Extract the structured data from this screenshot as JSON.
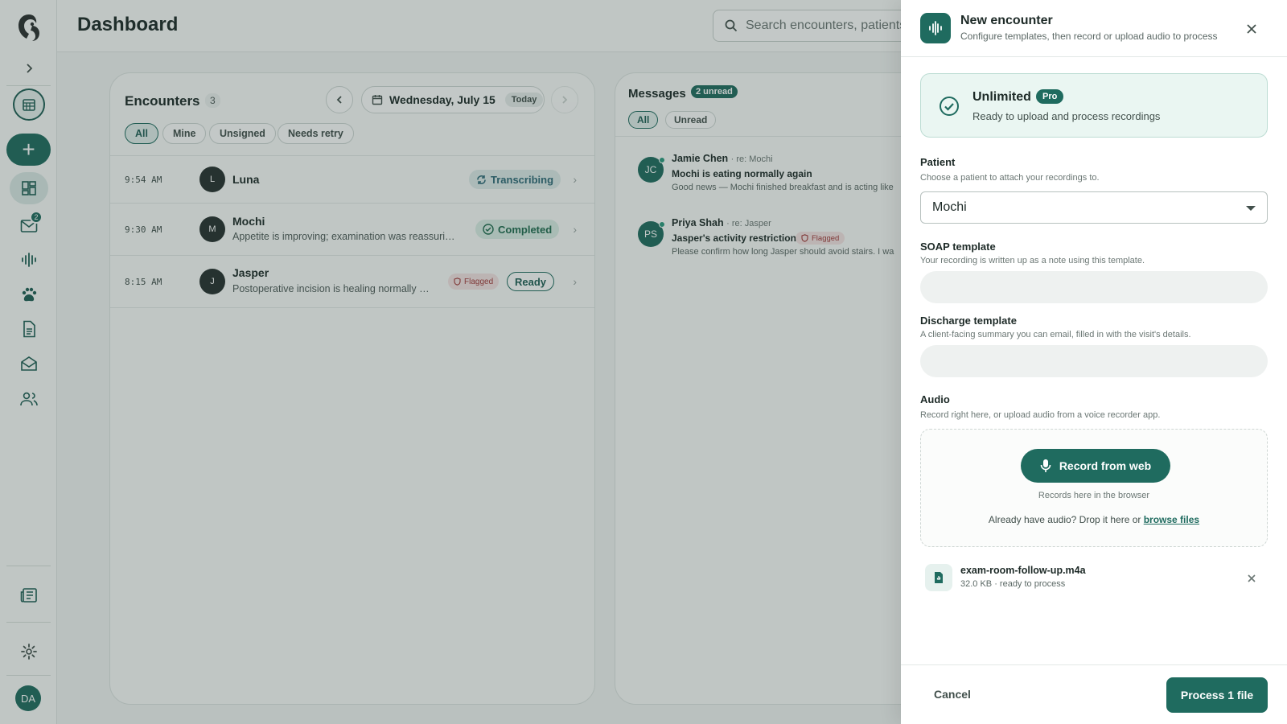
{
  "header": {
    "title": "Dashboard",
    "search_placeholder": "Search encounters, patients"
  },
  "sidebar": {
    "messages_badge": "2",
    "avatar_initials": "DA"
  },
  "encounters": {
    "title": "Encounters",
    "count": "3",
    "date": "Wednesday, July 15",
    "today_label": "Today",
    "filters": [
      "All",
      "Mine",
      "Unsigned",
      "Needs retry"
    ],
    "rows": [
      {
        "time": "9:54 AM",
        "initial": "L",
        "name": "Luna",
        "summary": "",
        "status": "Transcribing",
        "flag": ""
      },
      {
        "time": "9:30 AM",
        "initial": "M",
        "name": "Mochi",
        "summary": "Appetite is improving; examination was reassuring …",
        "status": "Completed",
        "flag": ""
      },
      {
        "time": "8:15 AM",
        "initial": "J",
        "name": "Jasper",
        "summary": "Postoperative incision is healing normally wit…",
        "status": "Ready",
        "flag": "Flagged"
      }
    ]
  },
  "messages": {
    "title": "Messages",
    "unread_badge": "2 unread",
    "filters": [
      "All",
      "Unread"
    ],
    "items": [
      {
        "initials": "JC",
        "from": "Jamie Chen",
        "re": "· re: Mochi",
        "subject": "Mochi is eating normally again",
        "flag": "",
        "preview": "Good news — Mochi finished breakfast and is acting like"
      },
      {
        "initials": "PS",
        "from": "Priya Shah",
        "re": "· re: Jasper",
        "subject": "Jasper's activity restriction",
        "flag": "Flagged",
        "preview": "Please confirm how long Jasper should avoid stairs. I wa"
      }
    ]
  },
  "drawer": {
    "title": "New encounter",
    "subtitle": "Configure templates, then record or upload audio to process",
    "plan": {
      "name": "Unlimited",
      "tier": "Pro",
      "description": "Ready to upload and process recordings"
    },
    "patient": {
      "label": "Patient",
      "help": "Choose a patient to attach your recordings to.",
      "value": "Mochi"
    },
    "soap": {
      "label": "SOAP template",
      "help": "Your recording is written up as a note using this template."
    },
    "discharge": {
      "label": "Discharge template",
      "help": "A client-facing summary you can email, filled in with the visit's details."
    },
    "audio": {
      "label": "Audio",
      "help": "Record right here, or upload audio from a voice recorder app.",
      "record_label": "Record from web",
      "record_hint": "Records here in the browser",
      "drop_text": "Already have audio? Drop it here or ",
      "browse_label": "browse files"
    },
    "file": {
      "name": "exam-room-follow-up.m4a",
      "meta": "32.0 KB · ready to process"
    },
    "cancel_label": "Cancel",
    "process_label": "Process 1 file"
  },
  "colors": {
    "brand": "#1f6b5f",
    "flag": "#a23a3a"
  }
}
